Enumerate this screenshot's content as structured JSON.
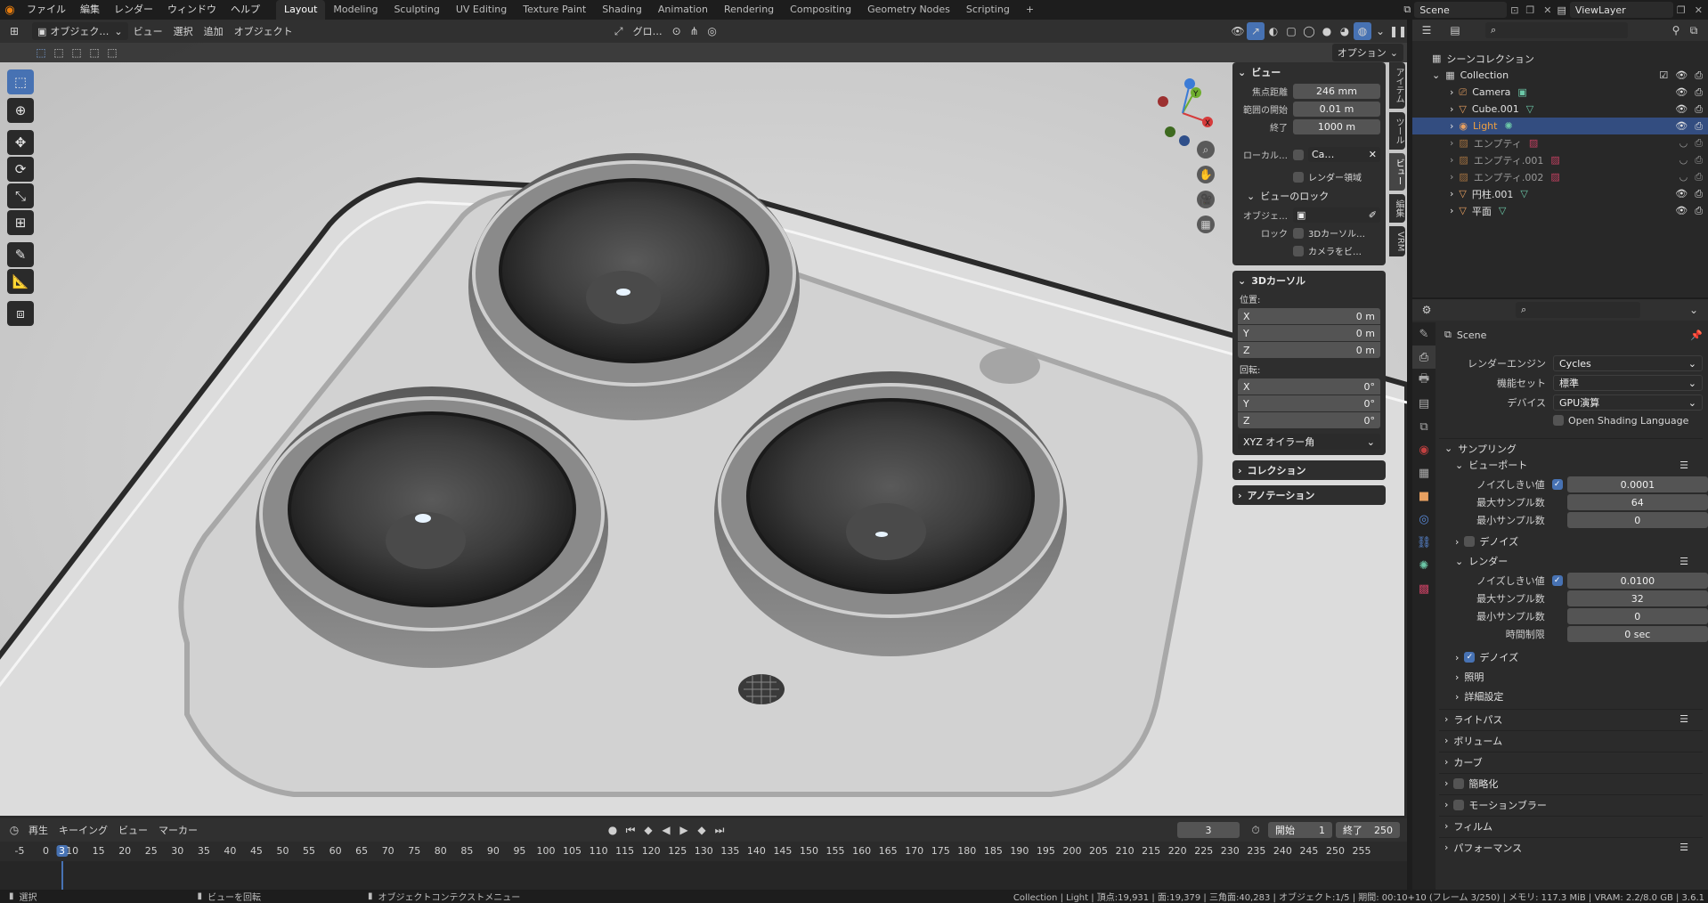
{
  "topbar": {
    "menus": [
      "ファイル",
      "編集",
      "レンダー",
      "ウィンドウ",
      "ヘルプ"
    ],
    "workspaces": [
      "Layout",
      "Modeling",
      "Sculpting",
      "UV Editing",
      "Texture Paint",
      "Shading",
      "Animation",
      "Rendering",
      "Compositing",
      "Geometry Nodes",
      "Scripting"
    ],
    "active_workspace": "Layout",
    "add_tab": "+",
    "scene": "Scene",
    "view_layer": "ViewLayer"
  },
  "viewport_header": {
    "mode": "オブジェク…",
    "menus": [
      "ビュー",
      "選択",
      "追加",
      "オブジェクト"
    ],
    "transform_orientation": "グロ…",
    "options_label": "オプション"
  },
  "npanel": {
    "view": {
      "title": "ビュー",
      "focal_label": "焦点距離",
      "focal_value": "246 mm",
      "clip_start_label": "範囲の開始",
      "clip_start_value": "0.01 m",
      "clip_end_label": "終了",
      "clip_end_value": "1000 m",
      "local_camera_label": "ローカル…",
      "local_camera_value": "Ca…",
      "render_region_label": "レンダー領域",
      "view_lock_title": "ビューのロック",
      "lock_object_label": "オブジェ…",
      "lock_label": "ロック",
      "lock_3dcursor": "3Dカーソル…",
      "lock_camera": "カメラをビ…"
    },
    "cursor": {
      "title": "3Dカーソル",
      "location_label": "位置:",
      "loc": [
        {
          "axis": "X",
          "value": "0 m"
        },
        {
          "axis": "Y",
          "value": "0 m"
        },
        {
          "axis": "Z",
          "value": "0 m"
        }
      ],
      "rotation_label": "回転:",
      "rot": [
        {
          "axis": "X",
          "value": "0°"
        },
        {
          "axis": "Y",
          "value": "0°"
        },
        {
          "axis": "Z",
          "value": "0°"
        }
      ],
      "rotation_mode": "XYZ オイラー角"
    },
    "collection_title": "コレクション",
    "annotation_title": "アノテーション",
    "side_tabs": [
      "アイテム",
      "ツール",
      "ビュー",
      "編集",
      "VRM"
    ],
    "active_side_tab": "ビュー"
  },
  "timeline": {
    "menus": [
      "再生",
      "キーイング",
      "ビュー",
      "マーカー"
    ],
    "current_frame": "3",
    "start_label": "開始",
    "start_value": "1",
    "end_label": "終了",
    "end_value": "250",
    "ticks": [
      "-5",
      "0",
      "3",
      "10",
      "15",
      "20",
      "25",
      "30",
      "35",
      "40",
      "45",
      "50",
      "55",
      "60",
      "65",
      "70",
      "75",
      "80",
      "85",
      "90",
      "95",
      "100",
      "105",
      "110",
      "115",
      "120",
      "125",
      "130",
      "135",
      "140",
      "145",
      "150",
      "155",
      "160",
      "165",
      "170",
      "175",
      "180",
      "185",
      "190",
      "195",
      "200",
      "205",
      "210",
      "215",
      "220",
      "225",
      "230",
      "235",
      "240",
      "245",
      "250",
      "255"
    ]
  },
  "statusbar": {
    "select": "選択",
    "rotate": "ビューを回転",
    "context": "オブジェクトコンテクストメニュー",
    "stats": "Collection | Light | 頂点:19,931 | 面:19,379 | 三角面:40,283 | オブジェクト:1/5 | 期間: 00:10+10 (フレーム 3/250) | メモリ: 117.3 MiB | VRAM: 2.2/8.0 GB | 3.6.1"
  },
  "outliner": {
    "root": "シーンコレクション",
    "collection": "Collection",
    "items": [
      {
        "name": "Camera",
        "state": "normal"
      },
      {
        "name": "Cube.001",
        "state": "normal"
      },
      {
        "name": "Light",
        "state": "selected"
      },
      {
        "name": "エンプティ",
        "state": "dim"
      },
      {
        "name": "エンプティ.001",
        "state": "dim"
      },
      {
        "name": "エンプティ.002",
        "state": "dim"
      },
      {
        "name": "円柱.001",
        "state": "normal"
      },
      {
        "name": "平面",
        "state": "normal"
      }
    ]
  },
  "properties": {
    "scene_name": "Scene",
    "render_engine_label": "レンダーエンジン",
    "render_engine": "Cycles",
    "feature_set_label": "機能セット",
    "feature_set": "標準",
    "device_label": "デバイス",
    "device": "GPU演算",
    "osl_label": "Open Shading Language",
    "sampling": "サンプリング",
    "viewport": "ビューポート",
    "noise_threshold_label": "ノイズしきい値",
    "vp_noise": "0.0001",
    "max_samples_label": "最大サンプル数",
    "vp_max": "64",
    "min_samples_label": "最小サンプル数",
    "vp_min": "0",
    "denoise": "デノイズ",
    "render": "レンダー",
    "r_noise": "0.0100",
    "r_max": "32",
    "r_min": "0",
    "time_limit_label": "時間制限",
    "r_time": "0 sec",
    "lights": "照明",
    "advanced": "詳細設定",
    "sections": [
      "ライトパス",
      "ボリューム",
      "カーブ",
      "簡略化",
      "モーションブラー",
      "フィルム",
      "パフォーマンス"
    ]
  },
  "colors": {
    "accent": "#4772b3",
    "selected_row": "#334d80",
    "light_name": "#f0a040"
  }
}
